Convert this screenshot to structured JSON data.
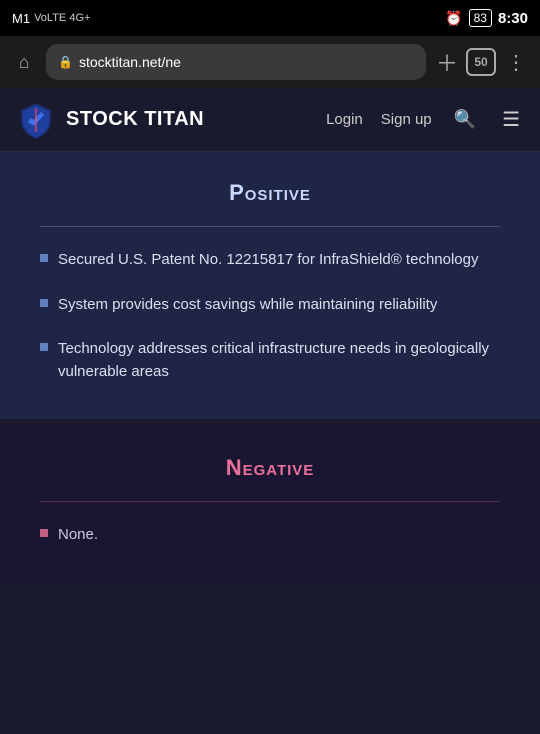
{
  "statusBar": {
    "carrier": "M1",
    "networkType": "VoLTE 4G+",
    "time": "8:30",
    "battery": "83"
  },
  "browserBar": {
    "url": "stocktitan.net/ne",
    "tabCount": "50"
  },
  "nav": {
    "logoText": "STOCK TITAN",
    "loginLabel": "Login",
    "signupLabel": "Sign up"
  },
  "positive": {
    "title": "Positive",
    "bullets": [
      "Secured U.S. Patent No. 12215817 for InfraShield® technology",
      "System provides cost savings while maintaining reliability",
      "Technology addresses critical infrastructure needs in geologically vulnerable areas"
    ]
  },
  "negative": {
    "title": "Negative",
    "bullets": [
      "None."
    ]
  }
}
